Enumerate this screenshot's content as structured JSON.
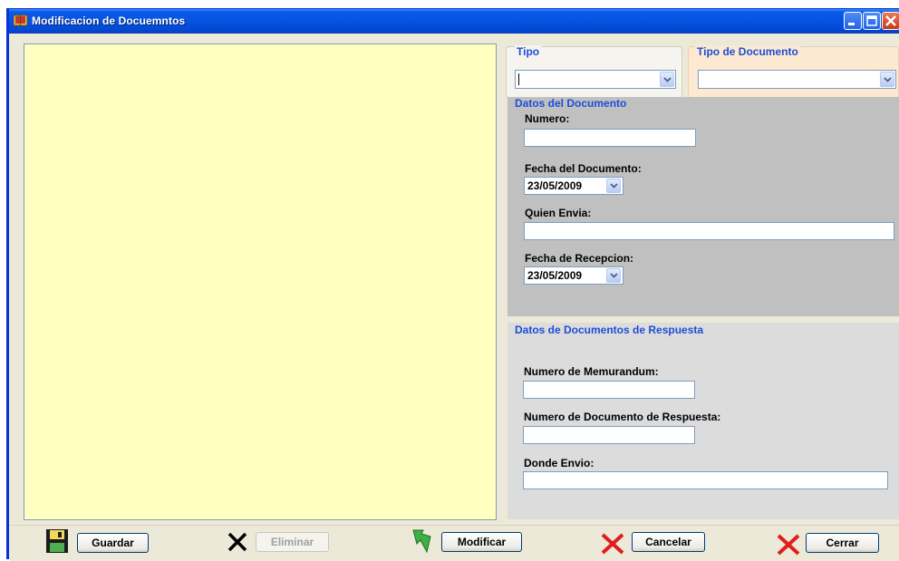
{
  "window": {
    "title": "Modificacion de Docuemntos",
    "title_bar_color": "#0a5ae8"
  },
  "viewer": {
    "background": "#ffffc0"
  },
  "tipo": {
    "legend": "Tipo",
    "value": ""
  },
  "tipo_documento": {
    "legend": "Tipo de Documento",
    "value": ""
  },
  "datos_documento": {
    "legend": "Datos del Documento",
    "numero_label": "Numero:",
    "numero_value": "",
    "fecha_documento_label": "Fecha del Documento:",
    "fecha_documento_value": "23/05/2009",
    "quien_envia_label": "Quien Envia:",
    "quien_envia_value": "",
    "fecha_recepcion_label": "Fecha de Recepcion:",
    "fecha_recepcion_value": "23/05/2009"
  },
  "datos_respuesta": {
    "legend": "Datos de Documentos de Respuesta",
    "numero_memorandum_label": "Numero de Memurandum:",
    "numero_memorandum_value": "",
    "numero_documento_respuesta_label": "Numero de Documento de Respuesta:",
    "numero_documento_respuesta_value": "",
    "donde_envio_label": "Donde Envio:",
    "donde_envio_value": ""
  },
  "toolbar": {
    "guardar": {
      "label": "Guardar",
      "icon": "floppy-disk-icon"
    },
    "eliminar": {
      "label": "Eliminar",
      "icon": "x-mark-icon",
      "enabled": false
    },
    "modificar": {
      "label": "Modificar",
      "icon": "green-arrow-icon"
    },
    "cancelar": {
      "label": "Cancelar",
      "icon": "red-x-icon"
    },
    "cerrar": {
      "label": "Cerrar",
      "icon": "red-x-icon"
    }
  },
  "colors": {
    "legend_blue": "#1c4ed8",
    "datos_documento_bg": "#c0c0c0",
    "datos_respuesta_bg": "#dcdcdc",
    "tipo_documento_bg": "#fde9d2"
  }
}
